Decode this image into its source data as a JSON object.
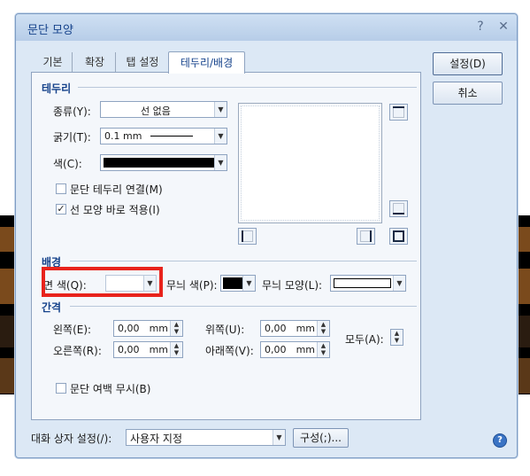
{
  "dialog": {
    "title": "문단 모양",
    "help_glyph": "?",
    "close_glyph": "✕"
  },
  "tabs": [
    {
      "label": "기본"
    },
    {
      "label": "확장"
    },
    {
      "label": "탭 설정"
    },
    {
      "label": "테두리/배경"
    }
  ],
  "buttons": {
    "ok": "설정(D)",
    "cancel": "취소",
    "config": "구성(;)..."
  },
  "border": {
    "section_title": "테두리",
    "type_label": "종류(Y):",
    "type_value": "선 없음",
    "thickness_label": "굵기(T):",
    "thickness_value": "0.1 mm",
    "color_label": "색(C):",
    "color_value": "#000000",
    "connect_label": "문단 테두리 연결(M)",
    "connect_checked": false,
    "apply_label": "선 모양 바로 적용(I)",
    "apply_checked": true,
    "check_glyph": "✓"
  },
  "background": {
    "section_title": "배경",
    "face_color_label": "면 색(Q):",
    "pattern_color_label": "무늬 색(P):",
    "pattern_color_value": "#000000",
    "pattern_shape_label": "무늬 모양(L):"
  },
  "spacing": {
    "section_title": "간격",
    "left_label": "왼쪽(E):",
    "left_value": "0,00",
    "right_label": "오른쪽(R):",
    "right_value": "0,00",
    "top_label": "위쪽(U):",
    "top_value": "0,00",
    "bottom_label": "아래쪽(V):",
    "bottom_value": "0,00",
    "all_label": "모두(A):",
    "unit": "mm",
    "ignore_margin_label": "문단 여백 무시(B)",
    "ignore_margin_checked": false
  },
  "footer": {
    "dialog_setting_label": "대화 상자 설정(/):",
    "dialog_setting_value": "사용자 지정"
  },
  "glyphs": {
    "dropdown": "▼",
    "spin_up": "▲",
    "spin_down": "▼"
  },
  "colors": {
    "highlight_box": "#e8231c",
    "accent": "#15428b"
  }
}
